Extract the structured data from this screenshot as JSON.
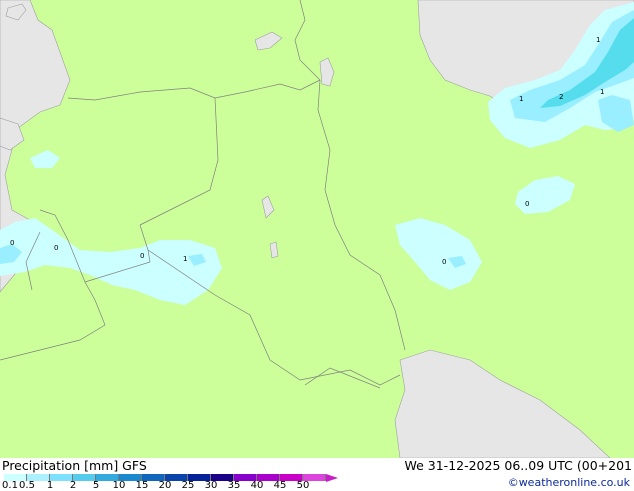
{
  "map": {
    "precip_labels": [
      {
        "id": "label-1-ne-top",
        "text": "1"
      },
      {
        "id": "label-1-ne-left",
        "text": "1"
      },
      {
        "id": "label-2-ne",
        "text": "2"
      },
      {
        "id": "label-1-ne-right",
        "text": "1"
      },
      {
        "id": "label-0-east",
        "text": "0"
      },
      {
        "id": "label-0-center",
        "text": "0"
      },
      {
        "id": "label-0-west-a",
        "text": "0"
      },
      {
        "id": "label-0-west-b",
        "text": "0"
      },
      {
        "id": "label-0-west-c",
        "text": "0"
      },
      {
        "id": "label-1-west",
        "text": "1"
      }
    ],
    "colors": {
      "land": "#ccff99",
      "sea": "#e6e6e6",
      "precip_light": "#ccffff",
      "precip_mid": "#99eeff",
      "precip_high": "#55ddee",
      "border": "#808080"
    }
  },
  "legend": {
    "title": "Precipitation [mm]  GFS",
    "datetime": "We 31-12-2025 06..09 UTC (00+201",
    "credit": "©weatheronline.co.uk",
    "ticks": [
      "0.1",
      "0.5",
      "1",
      "2",
      "5",
      "10",
      "15",
      "20",
      "25",
      "30",
      "35",
      "40",
      "45",
      "50"
    ],
    "colors": [
      "#ccffff",
      "#aaf0ff",
      "#7ee0ff",
      "#55ccee",
      "#33aadd",
      "#1a88cc",
      "#1166bb",
      "#0a44aa",
      "#052299",
      "#1a0088",
      "#8800cc",
      "#aa00cc",
      "#c800c8",
      "#dd44dd"
    ]
  }
}
